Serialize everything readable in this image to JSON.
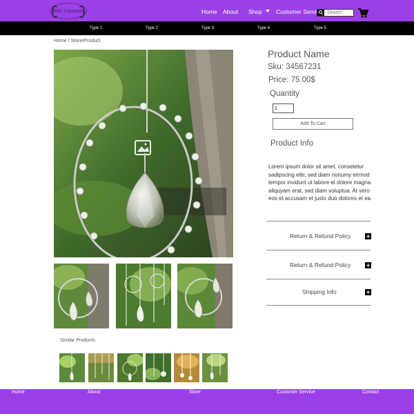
{
  "brand": {
    "logo_text": "Feliz Creations",
    "color": "#9b40e6"
  },
  "header": {
    "nav": [
      "Home",
      "About",
      "Shop",
      "Customer Service"
    ],
    "search_placeholder": "Search",
    "cart_icon": "cart-icon"
  },
  "categories": [
    "Type 1",
    "Type 2",
    "Type 3",
    "Type 4",
    "Type 5"
  ],
  "breadcrumb": "Home / Store/Product",
  "product": {
    "name": "Product Name",
    "sku": "Sku: 34567231",
    "price": "Price: 75.00$",
    "quantity_label": "Quantity",
    "quantity_value": "1",
    "add_to_cart": "Add To Cart",
    "info_title": "Product Info",
    "description": "Lorem ipsum dolor sit amet, consetetur sadipscing elitr, sed diam nonumy eirmod tempor invidunt ut labore et dolore magna aliquyam erat, sed diam voluptua. At vero eos et accusam et justo duo dolores et ea"
  },
  "accordion": [
    "Return & Refund Policy",
    "Return & Refund Policy",
    "Shipping Info"
  ],
  "similar_label": "Similar Products",
  "footer": [
    "Home",
    "About",
    "Store",
    "Customer Service",
    "Contact"
  ]
}
